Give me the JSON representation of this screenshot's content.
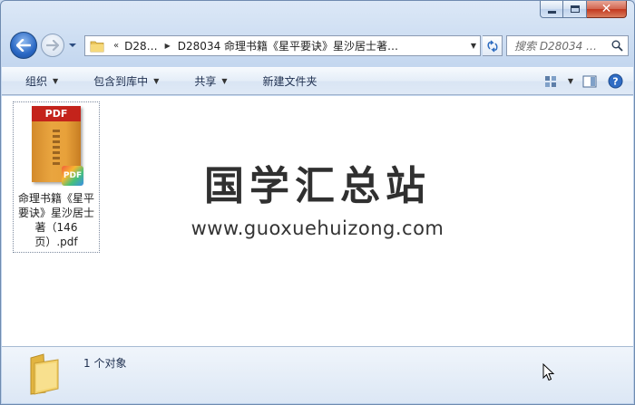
{
  "window": {
    "controls": {
      "minimize": "minimize",
      "maximize": "maximize",
      "close": "close"
    }
  },
  "navbar": {
    "breadcrumb": {
      "overflow": "«",
      "segment1": "D28…",
      "segment2": "D28034 命理书籍《星平要诀》星沙居士著…"
    },
    "search_placeholder": "搜索 D28034 …"
  },
  "toolbar": {
    "organize": "组织",
    "include_in_library": "包含到库中",
    "share": "共享",
    "new_folder": "新建文件夹"
  },
  "content": {
    "file": {
      "thumb_label": "PDF",
      "badge_label": "PDF",
      "name": "命理书籍《星平要诀》星沙居士著（146页）.pdf"
    },
    "watermark": {
      "title": "国学汇总站",
      "url": "www.guoxuehuizong.com"
    }
  },
  "details": {
    "count_text": "1 个对象"
  },
  "colors": {
    "window_frame": "#c4d7ef",
    "toolbar": "#dfe9f6",
    "pdf_red": "#c4231b",
    "book_orange": "#e9a53f"
  }
}
